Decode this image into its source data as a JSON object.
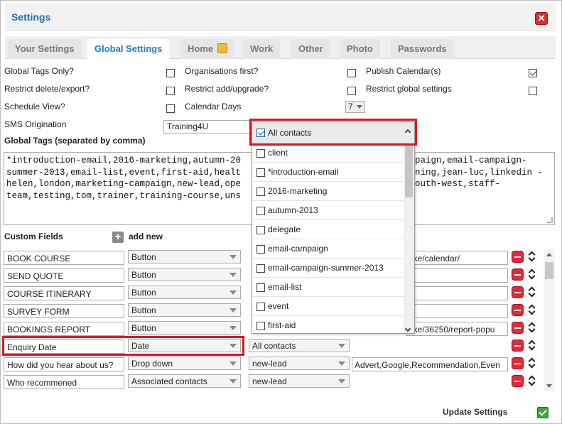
{
  "window": {
    "title": "Settings"
  },
  "tabs": [
    {
      "label": "Your Settings"
    },
    {
      "label": "Global Settings"
    },
    {
      "label": "Home"
    },
    {
      "label": "Work"
    },
    {
      "label": "Other"
    },
    {
      "label": "Photo"
    },
    {
      "label": "Passwords"
    }
  ],
  "options": {
    "global_tags_only": {
      "label": "Global Tags Only?",
      "checked": false
    },
    "organisations_first": {
      "label": "Organisations first?",
      "checked": false
    },
    "publish_calendar": {
      "label": "Publish Calendar(s)",
      "checked": true
    },
    "restrict_delete_export": {
      "label": "Restrict delete/export?",
      "checked": false
    },
    "restrict_add_upgrade": {
      "label": "Restrict add/upgrade?",
      "checked": false
    },
    "restrict_global_settings": {
      "label": "Restrict global settings",
      "checked": false
    },
    "schedule_view": {
      "label": "Schedule View?",
      "checked": false
    },
    "calendar_days": {
      "label": "Calendar Days",
      "value": "7"
    },
    "sms_origination": {
      "label": "SMS Origination",
      "value": "Training4U"
    }
  },
  "global_tags": {
    "label": "Global Tags (separated by comma)",
    "lines": [
      "*introduction-email,2016-marketing,autumn-20",
      "summer-2013,email-list,event,first-aid,healt",
      "helen,london,marketing-campaign,new-lead,ope",
      "team,testing,tom,trainer,training-course,uns"
    ],
    "lines_right": [
      "paign,email-campaign-",
      "ning,jean-luc,linkedin -",
      "outh-west,staff-",
      ""
    ]
  },
  "custom_fields": {
    "label": "Custom Fields",
    "add_new": "add new",
    "rows": [
      {
        "name": "BOOK COURSE",
        "type": "Button",
        "value": "oke/calendar/"
      },
      {
        "name": "SEND QUOTE",
        "type": "Button",
        "value": ""
      },
      {
        "name": "COURSE ITINERARY",
        "type": "Button",
        "value": ""
      },
      {
        "name": "SURVEY FORM",
        "type": "Button",
        "value": ""
      },
      {
        "name": "BOOKINGS REPORT",
        "type": "Button",
        "value": "oke/36250/report-popu"
      },
      {
        "name": "Enquiry Date",
        "type": "Date",
        "scope": "All contacts",
        "value": ""
      },
      {
        "name": "How did you hear about us?",
        "type": "Drop down",
        "scope": "new-lead",
        "value": "Advert,Google,Recommendation,Even"
      },
      {
        "name": "Who recommened",
        "type": "Associated contacts",
        "scope": "new-lead",
        "value": ""
      }
    ]
  },
  "dropdown": {
    "header": {
      "label": "All contacts",
      "checked": true
    },
    "items": [
      {
        "label": "client",
        "checked": false
      },
      {
        "label": "*introduction-email",
        "checked": false
      },
      {
        "label": "2016-marketing",
        "checked": false
      },
      {
        "label": "autumn-2013",
        "checked": false
      },
      {
        "label": "delegate",
        "checked": false
      },
      {
        "label": "email-campaign",
        "checked": false
      },
      {
        "label": "email-campaign-summer-2013",
        "checked": false
      },
      {
        "label": "email-list",
        "checked": false
      },
      {
        "label": "event",
        "checked": false
      },
      {
        "label": "first-aid",
        "checked": false
      }
    ]
  },
  "footer": {
    "update_label": "Update Settings"
  },
  "colors": {
    "title_blue": "#1f6fb5",
    "active_tab": "#1f7fc0",
    "highlight_red": "#e0161e",
    "remove_red": "#e02a3a",
    "ok_green": "#3ea63a"
  }
}
